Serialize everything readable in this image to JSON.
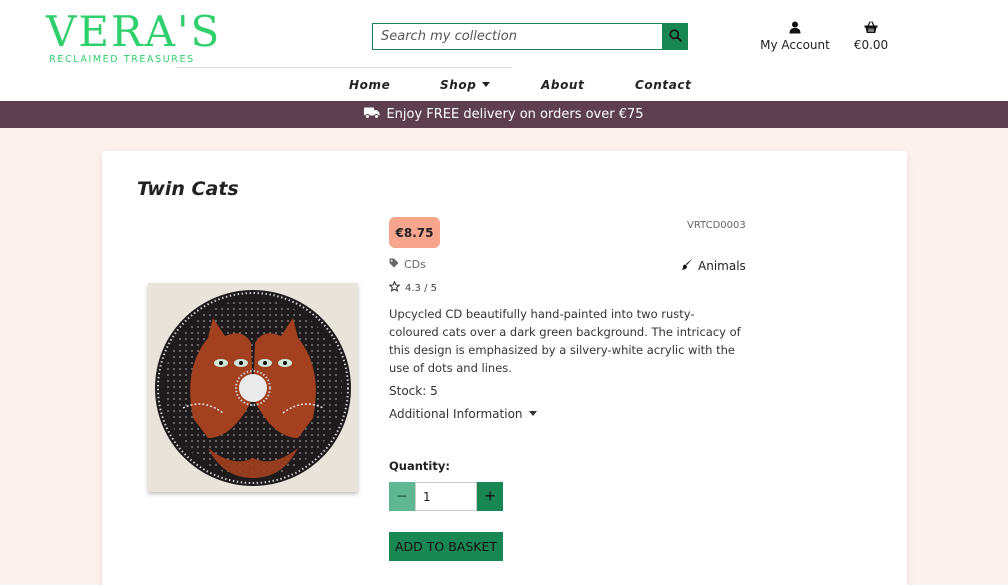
{
  "brand": {
    "name": "VERA'S",
    "tagline": "RECLAIMED TREASURES"
  },
  "search": {
    "placeholder": "Search my collection"
  },
  "header": {
    "account_label": "My Account",
    "basket_total": "€0.00"
  },
  "nav": {
    "items": [
      {
        "label": "Home"
      },
      {
        "label": "Shop"
      },
      {
        "label": "About"
      },
      {
        "label": "Contact"
      }
    ]
  },
  "promo": {
    "text": "Enjoy FREE delivery on orders over €75"
  },
  "product": {
    "title": "Twin Cats",
    "price": "€8.75",
    "sku": "VRTCD0003",
    "category": "CDs",
    "theme": "Animals",
    "rating": "4.3 / 5",
    "description": "Upcycled CD beautifully hand-painted into two rusty-coloured cats over a dark green background. The intricacy of this design is emphasized by a silvery-white acrylic with the use of dots and lines.",
    "stock": "Stock: 5",
    "additional_info_label": "Additional Information",
    "quantity_label": "Quantity:",
    "quantity_value": "1",
    "add_button_label": "ADD TO BASKET"
  },
  "colors": {
    "brand_green": "#2fd06c",
    "button_green": "#198754",
    "promo_bar": "#5e3f50",
    "price_badge": "#f7a58c",
    "page_bg": "#fdf1ee"
  },
  "icons": [
    "search-icon",
    "user-icon",
    "basket-icon",
    "truck-icon",
    "tag-icon",
    "paintbrush-icon",
    "star-icon",
    "caret-down-icon",
    "minus-icon",
    "plus-icon"
  ]
}
